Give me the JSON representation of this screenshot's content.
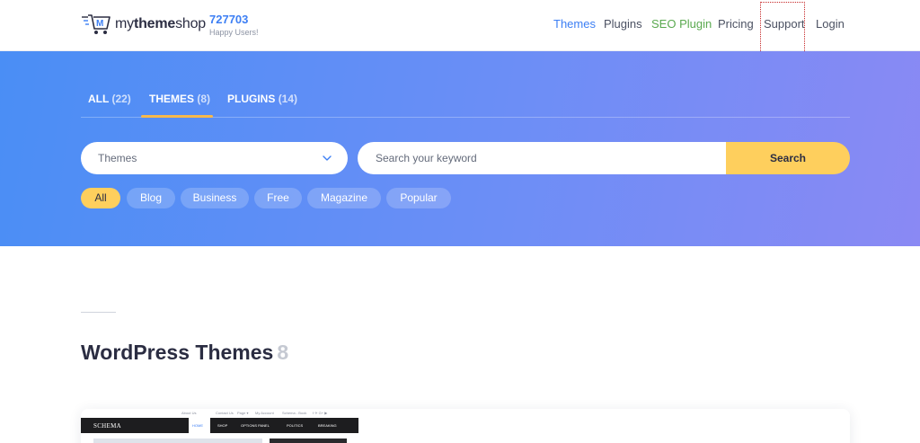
{
  "header": {
    "logo": {
      "brand_light": "my",
      "brand_bold": "theme",
      "brand_tail": "shop"
    },
    "users_count": "727703",
    "users_label": "Happy Users!",
    "nav": [
      "Themes",
      "Plugins",
      "SEO Plugin",
      "Pricing",
      "Support",
      "Login"
    ]
  },
  "hero": {
    "tabs": [
      {
        "label": "ALL",
        "count": "(22)"
      },
      {
        "label": "THEMES",
        "count": "(8)"
      },
      {
        "label": "PLUGINS",
        "count": "(14)"
      }
    ],
    "select_value": "Themes",
    "search_placeholder": "Search your keyword",
    "search_button": "Search",
    "chips": [
      "All",
      "Blog",
      "Business",
      "Free",
      "Magazine",
      "Popular"
    ]
  },
  "main": {
    "title": "WordPress Themes",
    "count": "8"
  },
  "preview": {
    "brand": "SCHEMA",
    "top_links": [
      "About Us",
      "Contact Us",
      "Page ▾",
      "My Account",
      "Schema - Book"
    ],
    "menu": [
      "HOME",
      "SHOP",
      "OPTIONS PANEL",
      "POLITICS",
      "BREAKING"
    ]
  },
  "colors": {
    "accent": "#3d7ff4",
    "seo_green": "#5aa94f",
    "search_yellow": "#fecf5d",
    "hero_start": "#4a8ef5",
    "hero_end": "#8a89f4"
  }
}
